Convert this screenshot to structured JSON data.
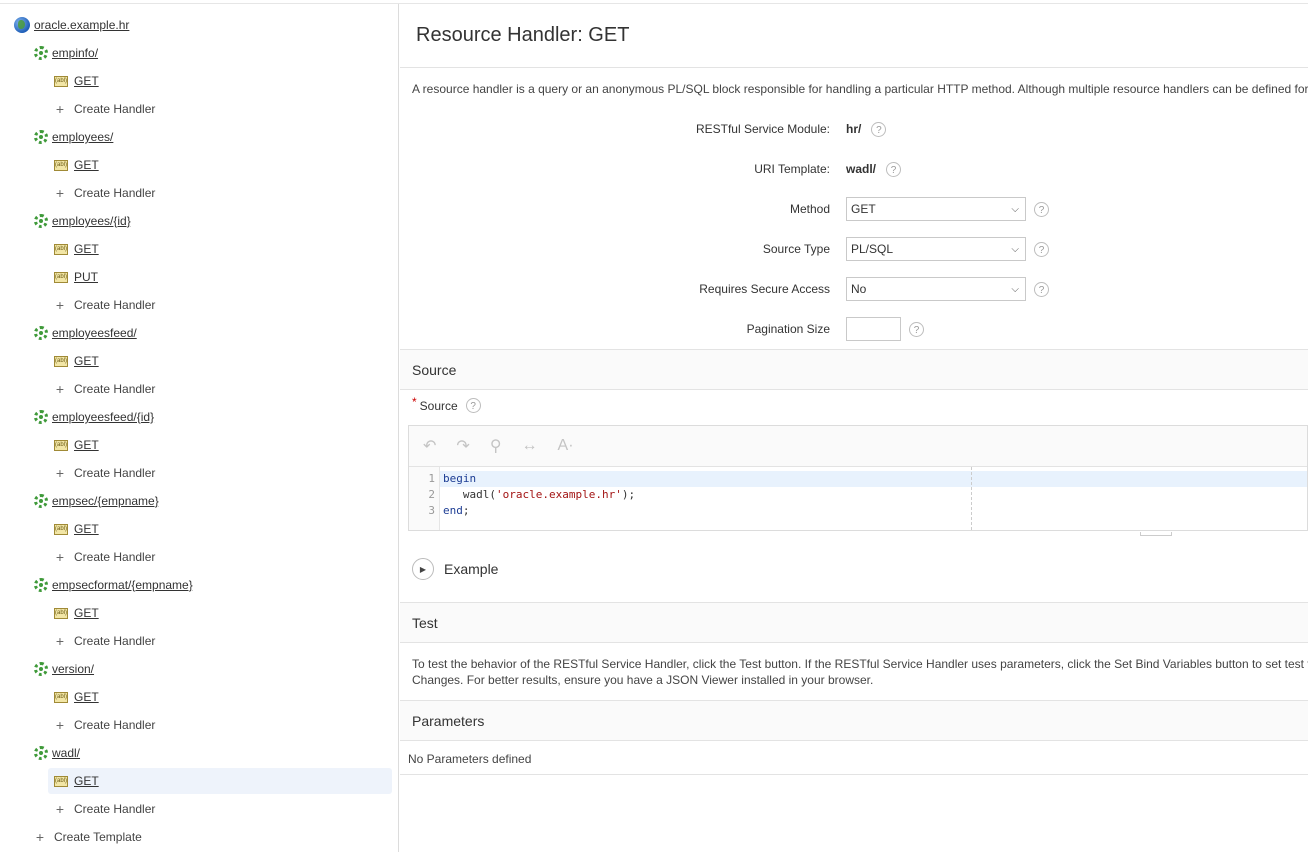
{
  "tree": {
    "root": "oracle.example.hr",
    "templates": [
      {
        "name": "empinfo/",
        "handlers": [
          "GET"
        ],
        "create": "Create Handler"
      },
      {
        "name": "employees/",
        "handlers": [
          "GET"
        ],
        "create": "Create Handler"
      },
      {
        "name": "employees/{id}",
        "handlers": [
          "GET",
          "PUT"
        ],
        "create": "Create Handler"
      },
      {
        "name": "employeesfeed/",
        "handlers": [
          "GET"
        ],
        "create": "Create Handler"
      },
      {
        "name": "employeesfeed/{id}",
        "handlers": [
          "GET"
        ],
        "create": "Create Handler"
      },
      {
        "name": "empsec/{empname}",
        "handlers": [
          "GET"
        ],
        "create": "Create Handler"
      },
      {
        "name": "empsecformat/{empname}",
        "handlers": [
          "GET"
        ],
        "create": "Create Handler"
      },
      {
        "name": "version/",
        "handlers": [
          "GET"
        ],
        "create": "Create Handler"
      },
      {
        "name": "wadl/",
        "handlers": [
          "GET"
        ],
        "create": "Create Handler"
      }
    ],
    "create_template": "Create Template",
    "handler_icon_text": "(abl)"
  },
  "page": {
    "title": "Resource Handler: GET",
    "description": "A resource handler is a query or an anonymous PL/SQL block responsible for handling a particular HTTP method. Although multiple resource handlers can be defined for",
    "help_glyph": "?"
  },
  "form": {
    "module_label": "RESTful Service Module:",
    "module_value": "hr/",
    "uri_label": "URI Template:",
    "uri_value": "wadl/",
    "method_label": "Method",
    "method_value": "GET",
    "source_type_label": "Source Type",
    "source_type_value": "PL/SQL",
    "secure_label": "Requires Secure Access",
    "secure_value": "No",
    "pagination_label": "Pagination Size",
    "pagination_value": ""
  },
  "source": {
    "section_title": "Source",
    "field_label": "Source",
    "required_mark": "*",
    "lines": [
      {
        "n": "1",
        "parts": [
          {
            "t": "begin",
            "c": "kw"
          }
        ]
      },
      {
        "n": "2",
        "parts": [
          {
            "t": "   wadl(",
            "c": ""
          },
          {
            "t": "'oracle.example.hr'",
            "c": "str"
          },
          {
            "t": ");",
            "c": ""
          }
        ]
      },
      {
        "n": "3",
        "parts": [
          {
            "t": "end",
            "c": "kw"
          },
          {
            "t": ";",
            "c": ""
          }
        ]
      }
    ],
    "example_label": "Example"
  },
  "test": {
    "section_title": "Test",
    "line1": "To test the behavior of the RESTful Service Handler, click the Test button. If the RESTful Service Handler uses parameters, click the Set Bind Variables button to set test valu",
    "line2": "Changes. For better results, ensure you have a JSON Viewer installed in your browser."
  },
  "parameters": {
    "section_title": "Parameters",
    "empty_text": "No Parameters defined"
  }
}
